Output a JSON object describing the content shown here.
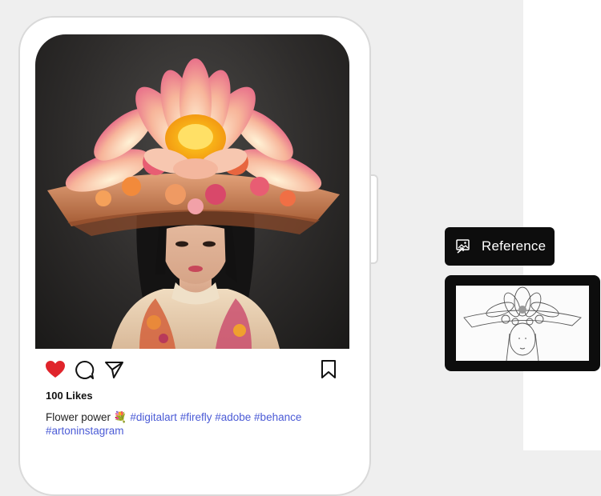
{
  "post": {
    "likes_text": "100 Likes",
    "caption_text": "Flower power",
    "caption_emoji": "💐",
    "hashtags": [
      "#digitalart",
      "#firefly",
      "#adobe",
      "#behance",
      "#artoninstagram"
    ],
    "image_alt": "Portrait of a woman wearing a large lotus flower headdress"
  },
  "actions": {
    "like_icon": "heart-icon",
    "comment_icon": "comment-icon",
    "share_icon": "send-icon",
    "save_icon": "bookmark-icon"
  },
  "reference": {
    "label": "Reference",
    "icon": "image-reference-icon",
    "thumbnail_alt": "Pencil sketch reference of woman with flower headdress"
  },
  "colors": {
    "heart": "#e0242b",
    "hashtag": "#4b5bd6",
    "panel_bg": "#0d0d0d"
  }
}
